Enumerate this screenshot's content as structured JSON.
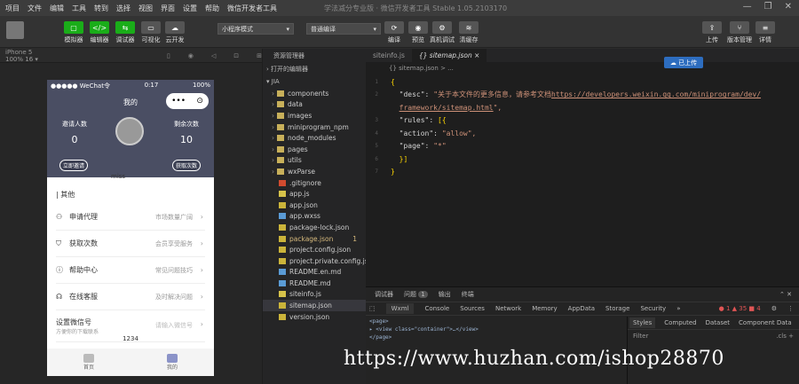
{
  "menu": [
    "项目",
    "文件",
    "编辑",
    "工具",
    "转到",
    "选择",
    "视图",
    "界面",
    "设置",
    "帮助",
    "微信开发者工具"
  ],
  "window_title": "学法减分专业版 · 微信开发者工具 Stable 1.05.2103170",
  "toolbar": {
    "left_buttons": [
      {
        "label": "模拟器",
        "icon": "▢"
      },
      {
        "label": "编辑器",
        "icon": "</>"
      },
      {
        "label": "调试器",
        "icon": "⇆"
      },
      {
        "label": "可视化",
        "icon": "▭"
      },
      {
        "label": "云开发",
        "icon": "☁"
      }
    ],
    "mode_select": "小程序模式",
    "compile_select": "普通编译",
    "mid_buttons": [
      "编译",
      "预览",
      "真机调试",
      "清缓存"
    ],
    "right_buttons": [
      "上传",
      "版本管理",
      "详情"
    ]
  },
  "simulator_bar": "iPhone 5 100% 16 ▾",
  "phone": {
    "status_left": "●●●●● WeChat令",
    "status_time": "0:17",
    "status_right": "100%",
    "title": "我的",
    "capsule_dots": "•••",
    "capsule_close": "⊙",
    "stat_left_label": "邀请人数",
    "stat_left_value": "0",
    "stat_left_btn": "立即邀请",
    "stat_right_label": "剩余次数",
    "stat_right_value": "10",
    "stat_right_btn": "获取次数",
    "username": "miss",
    "list_header": "| 其他",
    "rows": [
      {
        "icon": "⚇",
        "label": "申请代理",
        "value": "市场数量广阔"
      },
      {
        "icon": "⛉",
        "label": "获取次数",
        "value": "会员享受服务"
      },
      {
        "icon": "ⓘ",
        "label": "帮助中心",
        "value": "常见问题技巧"
      },
      {
        "icon": "☊",
        "label": "在线客服",
        "value": "及时解决问题"
      }
    ],
    "setting_label": "设置微信号",
    "setting_sub": "方便你的下载联系",
    "setting_placeholder": "请输入微信号",
    "footer": "1234",
    "tabs": [
      "首页",
      "我的"
    ]
  },
  "explorer": {
    "header": "资源管理器",
    "open_editors": "打开的编辑器",
    "project": "JIA",
    "files": [
      {
        "name": "components",
        "type": "folder"
      },
      {
        "name": "data",
        "type": "folder"
      },
      {
        "name": "images",
        "type": "folder"
      },
      {
        "name": "miniprogram_npm",
        "type": "folder"
      },
      {
        "name": "node_modules",
        "type": "folder"
      },
      {
        "name": "pages",
        "type": "folder"
      },
      {
        "name": "utils",
        "type": "folder"
      },
      {
        "name": "wxParse",
        "type": "folder"
      },
      {
        "name": ".gitignore",
        "type": "git"
      },
      {
        "name": "app.js",
        "type": "js"
      },
      {
        "name": "app.json",
        "type": "json"
      },
      {
        "name": "app.wxss",
        "type": "wx"
      },
      {
        "name": "package-lock.json",
        "type": "json"
      },
      {
        "name": "package.json",
        "type": "json",
        "badge": "1"
      },
      {
        "name": "project.config.json",
        "type": "json"
      },
      {
        "name": "project.private.config.js...",
        "type": "json"
      },
      {
        "name": "README.en.md",
        "type": "md"
      },
      {
        "name": "README.md",
        "type": "md"
      },
      {
        "name": "siteinfo.js",
        "type": "js"
      },
      {
        "name": "sitemap.json",
        "type": "json",
        "selected": true
      },
      {
        "name": "version.json",
        "type": "json"
      }
    ]
  },
  "editor": {
    "tabs": [
      "siteinfo.js",
      "{} sitemap.json ×"
    ],
    "breadcrumb": "{} sitemap.json > ...",
    "upload_pill": "已上传",
    "lines": [
      {
        "n": "1",
        "t": "{"
      },
      {
        "n": "2",
        "k": "\"desc\"",
        "v": "\"关于本文件的更多信息，请参考文档 ",
        "url": "https://developers.weixin.qq.com/miniprogram/dev/"
      },
      {
        "n": "",
        "url2": "framework/sitemap.html",
        "tail": "\","
      },
      {
        "n": "3",
        "k": "\"rules\"",
        "v": "[{"
      },
      {
        "n": "4",
        "k": "\"action\"",
        "v": "\"allow\","
      },
      {
        "n": "5",
        "k": "\"page\"",
        "v": "\"*\""
      },
      {
        "n": "6",
        "t": "}]"
      },
      {
        "n": "7",
        "t": "}"
      }
    ]
  },
  "devtools": {
    "top_tabs": [
      "调试器",
      "问题",
      "输出",
      "终端"
    ],
    "issue_count": "1",
    "panels": [
      "Wxml",
      "Console",
      "Sources",
      "Network",
      "Memory",
      "AppData",
      "Storage",
      "Security"
    ],
    "counters": "● 1 ▲ 35 ■ 4",
    "dom_lines": [
      "<page>",
      "▸ <view class=\"container\">…</view>",
      "</page>"
    ],
    "style_tabs": [
      "Styles",
      "Computed",
      "Dataset",
      "Component Data"
    ],
    "filter_label": "Filter",
    "cls_label": ".cls",
    "plus_label": "+"
  },
  "watermark": "https://www.huzhan.com/ishop28870"
}
